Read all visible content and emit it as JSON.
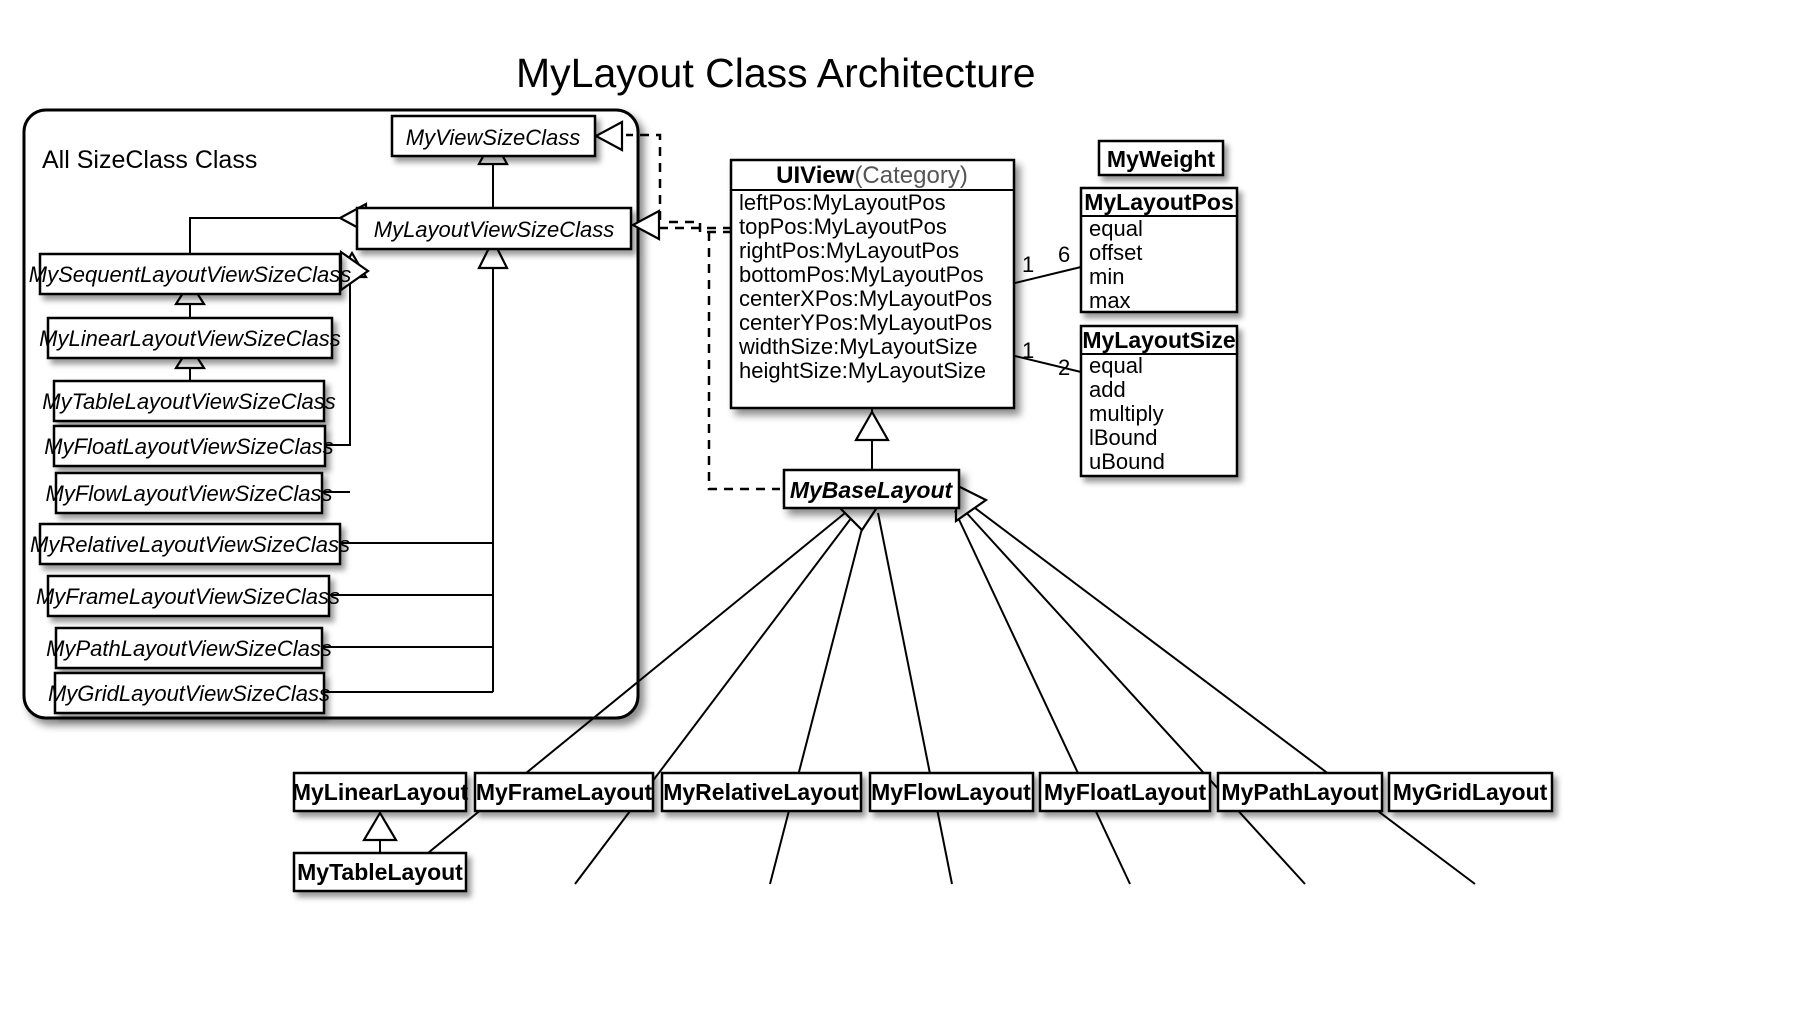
{
  "title": "MyLayout Class Architecture",
  "group_panel": {
    "label": "All SizeClass Class"
  },
  "size_classes": {
    "root": "MyViewSizeClass",
    "layout_view": "MyLayoutViewSizeClass",
    "sequent": "MySequentLayoutViewSizeClass",
    "linear": "MyLinearLayoutViewSizeClass",
    "table": "MyTableLayoutViewSizeClass",
    "float": "MyFloatLayoutViewSizeClass",
    "flow": "MyFlowLayoutViewSizeClass",
    "relative": "MyRelativeLayoutViewSizeClass",
    "frame": "MyFrameLayoutViewSizeClass",
    "path": "MyPathLayoutViewSizeClass",
    "grid": "MyGridLayoutViewSizeClass"
  },
  "uiview": {
    "name": "UIView",
    "category": "(Category)",
    "attributes": [
      "leftPos:MyLayoutPos",
      "topPos:MyLayoutPos",
      "rightPos:MyLayoutPos",
      "bottomPos:MyLayoutPos",
      "centerXPos:MyLayoutPos",
      "centerYPos:MyLayoutPos",
      "widthSize:MyLayoutSize",
      "heightSize:MyLayoutSize"
    ]
  },
  "my_weight": {
    "name": "MyWeight"
  },
  "my_layout_pos": {
    "name": "MyLayoutPos",
    "members": [
      "equal",
      "offset",
      "min",
      "max"
    ],
    "multiplicity_source": "1",
    "multiplicity_target": "6"
  },
  "my_layout_size": {
    "name": "MyLayoutSize",
    "members": [
      "equal",
      "add",
      "multiply",
      "lBound",
      "uBound"
    ],
    "multiplicity_source": "1",
    "multiplicity_target": "2"
  },
  "base_layout": {
    "name": "MyBaseLayout"
  },
  "layouts": [
    "MyLinearLayout",
    "MyFrameLayout",
    "MyRelativeLayout",
    "MyFlowLayout",
    "MyFloatLayout",
    "MyPathLayout",
    "MyGridLayout"
  ],
  "table_layout": {
    "name": "MyTableLayout"
  },
  "colors": {
    "background": "#ffffff",
    "stroke": "#000000",
    "category_text": "#555555"
  }
}
